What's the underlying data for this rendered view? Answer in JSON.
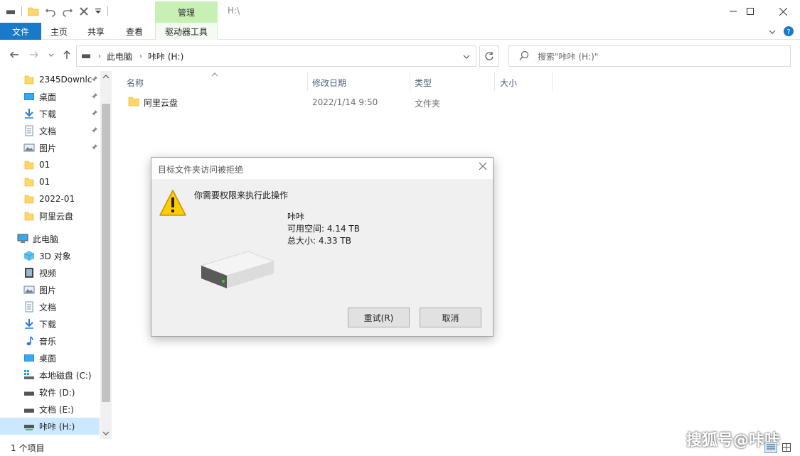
{
  "titlebar": {
    "manage_tab": "管理",
    "title": "H:\\"
  },
  "ribbon": {
    "tabs": [
      "文件",
      "主页",
      "共享",
      "查看",
      "驱动器工具"
    ]
  },
  "address": {
    "crumbs": [
      "此电脑",
      "咔咔 (H:)"
    ],
    "search_placeholder": "搜索\"咔咔 (H:)\""
  },
  "sidebar": {
    "items": [
      {
        "label": "2345Downlc",
        "icon": "folder-icon",
        "pinned": true
      },
      {
        "label": "桌面",
        "icon": "desktop-icon",
        "pinned": true
      },
      {
        "label": "下载",
        "icon": "download-icon",
        "pinned": true
      },
      {
        "label": "文档",
        "icon": "document-icon",
        "pinned": true
      },
      {
        "label": "图片",
        "icon": "picture-icon",
        "pinned": true
      },
      {
        "label": "01",
        "icon": "folder-icon"
      },
      {
        "label": "01",
        "icon": "folder-icon"
      },
      {
        "label": "2022-01",
        "icon": "folder-icon"
      },
      {
        "label": "阿里云盘",
        "icon": "folder-icon"
      },
      {
        "label": "此电脑",
        "icon": "computer-icon"
      },
      {
        "label": "3D 对象",
        "icon": "3d-objects-icon"
      },
      {
        "label": "视频",
        "icon": "video-icon"
      },
      {
        "label": "图片",
        "icon": "picture-icon"
      },
      {
        "label": "文档",
        "icon": "document-icon"
      },
      {
        "label": "下载",
        "icon": "download-icon"
      },
      {
        "label": "音乐",
        "icon": "music-icon"
      },
      {
        "label": "桌面",
        "icon": "desktop-icon"
      },
      {
        "label": "本地磁盘 (C:)",
        "icon": "system-drive-icon"
      },
      {
        "label": "软件 (D:)",
        "icon": "drive-icon"
      },
      {
        "label": "文档 (E:)",
        "icon": "drive-icon"
      },
      {
        "label": "咔咔 (H:)",
        "icon": "network-drive-icon",
        "selected": true
      }
    ]
  },
  "columns": {
    "name": "名称",
    "modified": "修改日期",
    "type": "类型",
    "size": "大小"
  },
  "files": [
    {
      "name": "阿里云盘",
      "modified": "2022/1/14 9:50",
      "type": "文件夹"
    }
  ],
  "status": {
    "count": "1 个项目"
  },
  "watermark": "搜狐号@咔咔",
  "dialog": {
    "title": "目标文件夹访问被拒绝",
    "message": "你需要权限来执行此操作",
    "drive_name": "咔咔",
    "free_space": "可用空间: 4.14 TB",
    "total_size": "总大小: 4.33 TB",
    "retry": "重试(R)",
    "cancel": "取消"
  },
  "colors": {
    "file_tab": "#1979ca",
    "manage_tab": "#c7f0b5",
    "selected": "#cce8ff",
    "folder": "#ffd767"
  }
}
